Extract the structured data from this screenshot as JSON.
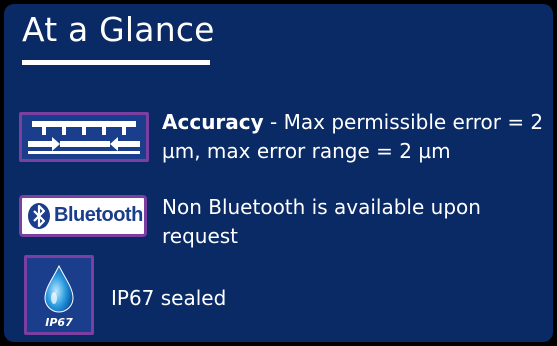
{
  "header": {
    "title": "At a Glance"
  },
  "features": [
    {
      "icon": "caliper-scale-icon",
      "bold": "Accuracy",
      "text": " - Max permissible error = 2 µm, max error range = 2 µm"
    },
    {
      "icon": "bluetooth-logo-icon",
      "logo_text": "Bluetooth",
      "text": "Non Bluetooth is available upon request"
    },
    {
      "icon": "water-drop-icon",
      "badge": "IP67",
      "text": "IP67 sealed"
    }
  ],
  "colors": {
    "panel": "#0a2a66",
    "frame": "#7a3fa0",
    "accent": "#1a3e8c",
    "text": "#ffffff"
  }
}
